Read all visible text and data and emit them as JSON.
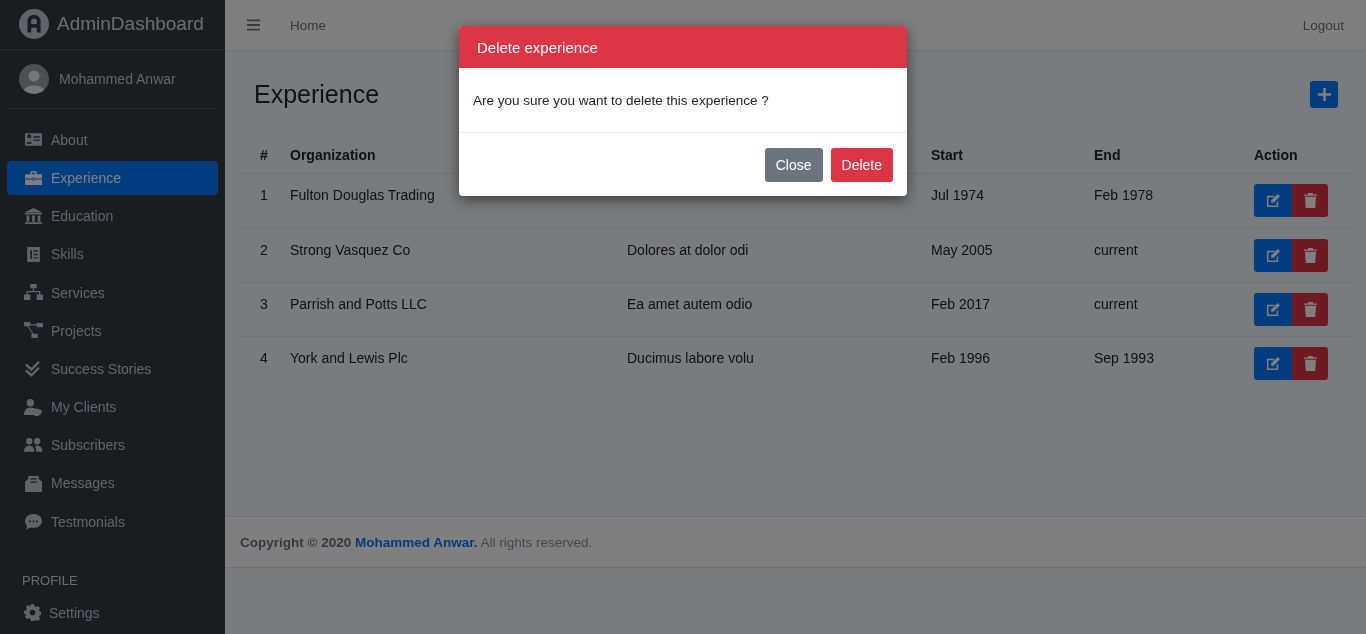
{
  "brand": {
    "title": "AdminDashboard"
  },
  "user": {
    "name": "Mohammed Anwar"
  },
  "sidebar": {
    "items": [
      {
        "label": "About",
        "selected": false
      },
      {
        "label": "Experience",
        "selected": true
      },
      {
        "label": "Education",
        "selected": false
      },
      {
        "label": "Skills",
        "selected": false
      },
      {
        "label": "Services",
        "selected": false
      },
      {
        "label": "Projects",
        "selected": false
      },
      {
        "label": "Success Stories",
        "selected": false
      },
      {
        "label": "My Clients",
        "selected": false
      },
      {
        "label": "Subscribers",
        "selected": false
      },
      {
        "label": "Messages",
        "selected": false
      },
      {
        "label": "Testmonials",
        "selected": false
      }
    ],
    "section_header": "PROFILE",
    "profile_items": [
      {
        "label": "Settings",
        "selected": false
      }
    ]
  },
  "topbar": {
    "home": "Home",
    "logout": "Logout"
  },
  "page": {
    "title": "Experience"
  },
  "table": {
    "columns": {
      "number": "#",
      "organization": "Organization",
      "start": "Start",
      "end": "End",
      "action": "Action"
    },
    "rows": [
      {
        "number": "1",
        "organization": "Fulton Douglas Trading",
        "start": "Jul 1974",
        "end": "Feb 1978"
      },
      {
        "number": "2",
        "organization": "Strong Vasquez Co",
        "column_3": "Dolores at dolor odi",
        "start": "May 2005",
        "end": "current"
      },
      {
        "number": "3",
        "organization": "Parrish and Potts LLC",
        "column_3": "Ea amet autem odio",
        "start": "Feb 2017",
        "end": "current"
      },
      {
        "number": "4",
        "organization": "York and Lewis Plc",
        "column_3": "Ducimus labore volu",
        "start": "Feb 1996",
        "end": "Sep 1993"
      }
    ]
  },
  "footer": {
    "prefix": "Copyright © 2020",
    "link": "Mohammed Anwar.",
    "suffix": "All rights reserved."
  },
  "modal": {
    "title": "Delete experience",
    "message": "Are you sure you want to delete this experience ?",
    "buttons": [
      {
        "label": "Close",
        "kind": "secondary"
      },
      {
        "label": "Delete",
        "kind": "danger"
      }
    ]
  }
}
